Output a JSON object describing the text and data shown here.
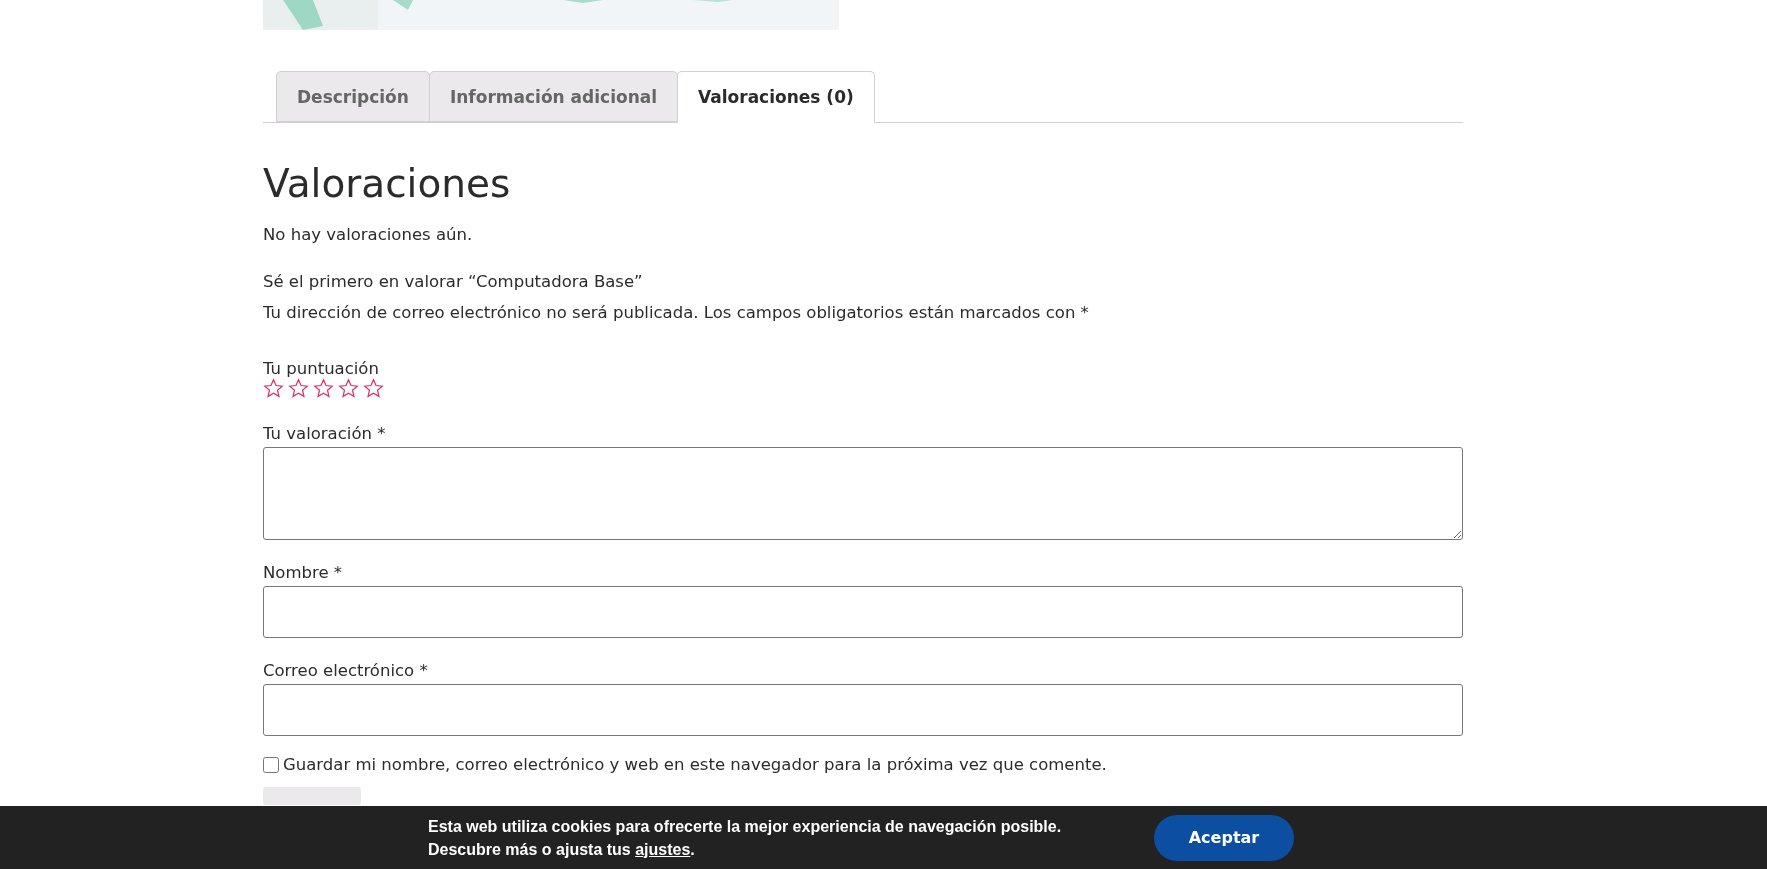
{
  "tabs": [
    {
      "label": "Descripción",
      "selected": false
    },
    {
      "label": "Información adicional",
      "selected": false
    },
    {
      "label": "Valoraciones (0)",
      "selected": true
    }
  ],
  "reviews": {
    "title": "Valoraciones",
    "empty_text": "No hay valoraciones aún.",
    "first_review": "Sé el primero en valorar “Computadora Base”",
    "notice": "Tu dirección de correo electrónico no será publicada. Los campos obligatorios están marcados con *"
  },
  "rating": {
    "label": "Tu puntuación",
    "stars": 0
  },
  "fields": [
    {
      "label": "Tu valoración *",
      "kind": "textarea"
    },
    {
      "label": "Nombre *",
      "kind": "input"
    },
    {
      "label": "Correo electrónico *",
      "kind": "input"
    }
  ],
  "save_info": {
    "label": "Guardar mi nombre, correo electrónico y web en este navegador para la próxima vez que comente.",
    "checked": false
  },
  "cookie_bar": {
    "line_1": "Esta web utiliza cookies para ofrecerte la mejor experiencia de navegación posible.",
    "line_2_before": "Descubre más o ajusta tus ",
    "link": "ajustes",
    "line_2_after": ".",
    "button": "Aceptar"
  }
}
